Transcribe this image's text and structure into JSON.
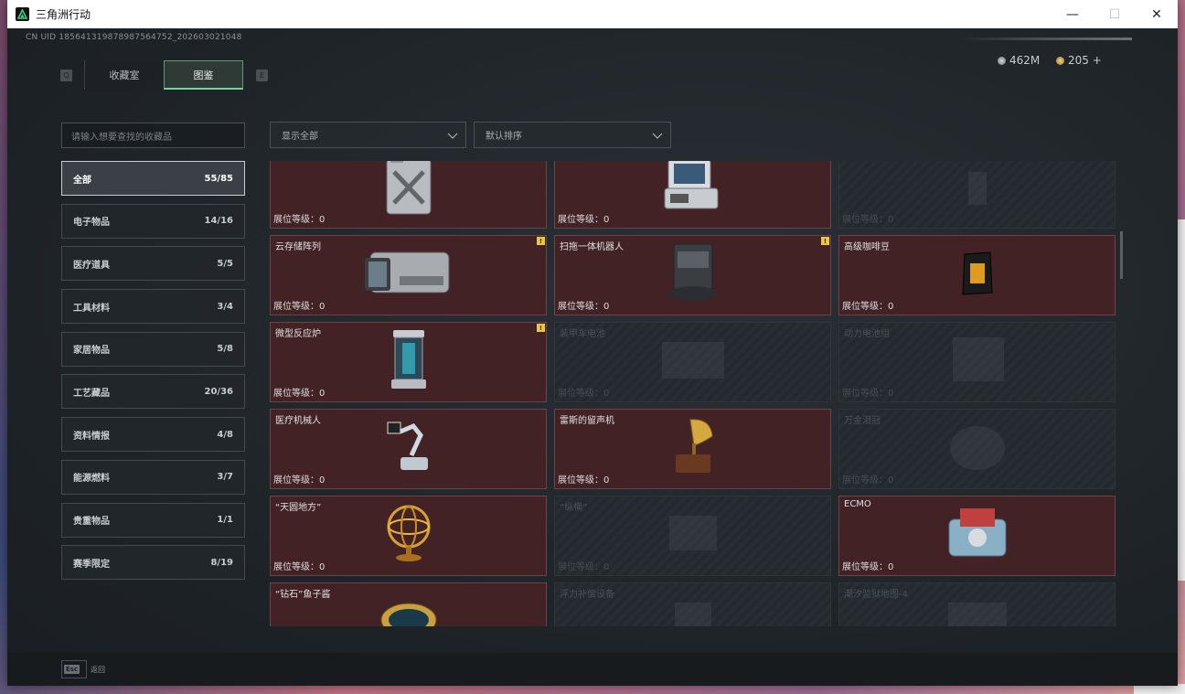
{
  "window": {
    "title": "三角洲行动",
    "minimize": "—",
    "maximize": "☐",
    "close": "✕"
  },
  "header": {
    "uid": "CN UID 185641319878987564752_202603021048",
    "currency_1": "462M",
    "currency_2": "205 +",
    "key_left": "Q",
    "key_right": "E"
  },
  "tabs": [
    {
      "label": "收藏室",
      "active": false
    },
    {
      "label": "图鉴",
      "active": true
    }
  ],
  "search": {
    "placeholder": "请输入想要查找的收藏品"
  },
  "filters": {
    "show": "显示全部",
    "sort": "默认排序"
  },
  "categories": [
    {
      "label": "全部",
      "count": "55/85",
      "active": true
    },
    {
      "label": "电子物品",
      "count": "14/16"
    },
    {
      "label": "医疗道具",
      "count": "5/5"
    },
    {
      "label": "工具材料",
      "count": "3/4"
    },
    {
      "label": "家居物品",
      "count": "5/8"
    },
    {
      "label": "工艺藏品",
      "count": "20/36"
    },
    {
      "label": "资料情报",
      "count": "4/8"
    },
    {
      "label": "能源燃料",
      "count": "3/7"
    },
    {
      "label": "贵重物品",
      "count": "1/1"
    },
    {
      "label": "赛季限定",
      "count": "8/19"
    }
  ],
  "items": [
    {
      "name": "",
      "level": "展位等级：0",
      "owned": true,
      "icon": "jerrycan-icon",
      "badge": false
    },
    {
      "name": "",
      "level": "展位等级：0",
      "owned": true,
      "icon": "terminal-icon",
      "badge": false
    },
    {
      "name": "",
      "level": "展位等级：0",
      "owned": false,
      "icon": "locked-item-icon",
      "badge": false
    },
    {
      "name": "云存储阵列",
      "level": "展位等级：0",
      "owned": true,
      "icon": "storage-array-icon",
      "badge": true
    },
    {
      "name": "扫拖一体机器人",
      "level": "展位等级：0",
      "owned": true,
      "icon": "mop-robot-icon",
      "badge": true
    },
    {
      "name": "高级咖啡豆",
      "level": "展位等级：0",
      "owned": true,
      "icon": "coffee-bag-icon",
      "badge": false
    },
    {
      "name": "微型反应炉",
      "level": "展位等级：0",
      "owned": true,
      "icon": "reactor-icon",
      "badge": true
    },
    {
      "name": "装甲车电池",
      "level": "展位等级：0",
      "owned": false,
      "icon": "battery-icon",
      "badge": false
    },
    {
      "name": "动力电池组",
      "level": "展位等级：0",
      "owned": false,
      "icon": "battery-pack-icon",
      "badge": false
    },
    {
      "name": "医疗机械人",
      "level": "展位等级：0",
      "owned": true,
      "icon": "medical-robot-icon",
      "badge": false
    },
    {
      "name": "雷斯的留声机",
      "level": "展位等级：0",
      "owned": true,
      "icon": "gramophone-icon",
      "badge": false
    },
    {
      "name": "万金泪冠",
      "level": "展位等级：0",
      "owned": false,
      "icon": "crown-icon",
      "badge": false
    },
    {
      "name": "“天圆地方”",
      "level": "展位等级：0",
      "owned": true,
      "icon": "armillary-icon",
      "badge": false
    },
    {
      "name": "“纵横”",
      "level": "展位等级：0",
      "owned": false,
      "icon": "chessboard-icon",
      "badge": false
    },
    {
      "name": "ECMO",
      "level": "展位等级：0",
      "owned": true,
      "icon": "ecmo-icon",
      "badge": false
    },
    {
      "name": "“钻石”鱼子酱",
      "level": "",
      "owned": true,
      "icon": "caviar-icon",
      "badge": false
    },
    {
      "name": "浮力补偿设备",
      "level": "",
      "owned": false,
      "icon": "bcd-icon",
      "badge": false
    },
    {
      "name": "潮汐监狱地图-4",
      "level": "",
      "owned": false,
      "icon": "map-icon",
      "badge": false
    }
  ],
  "badge_glyph": "!",
  "footer": {
    "esc_key": "Esc",
    "esc_label": "返回"
  }
}
